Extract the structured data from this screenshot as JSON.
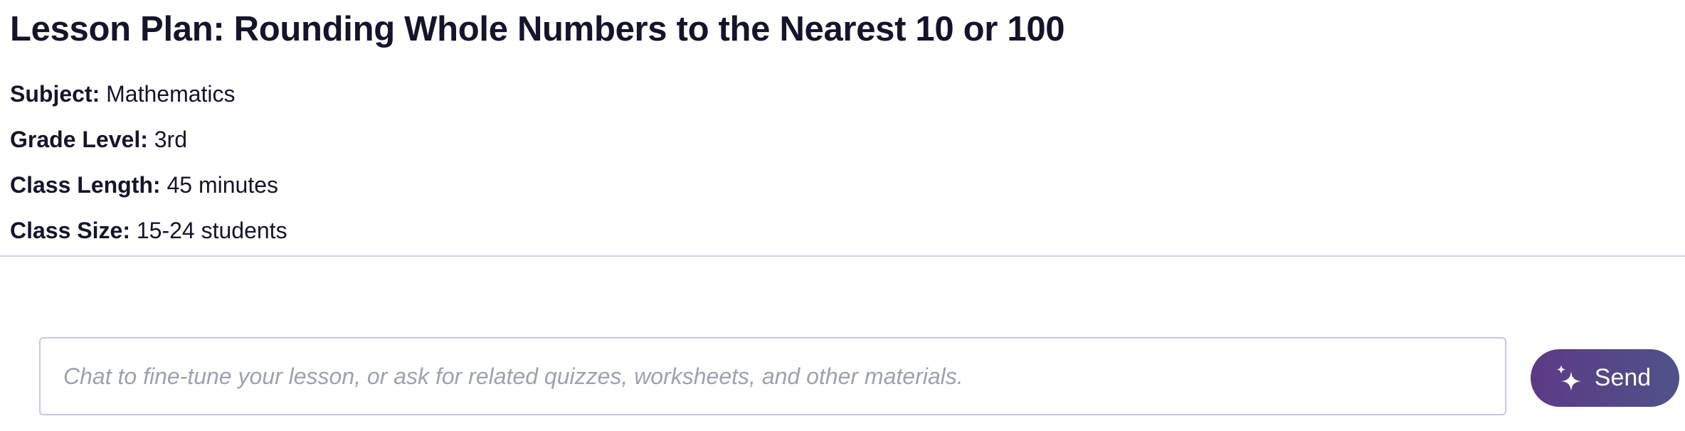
{
  "lesson": {
    "title": "Lesson Plan: Rounding Whole Numbers to the Nearest 10 or 100",
    "details": [
      {
        "label": "Subject:",
        "value": "Mathematics"
      },
      {
        "label": "Grade Level:",
        "value": "3rd"
      },
      {
        "label": "Class Length:",
        "value": "45 minutes"
      },
      {
        "label": "Class Size:",
        "value": "15-24 students"
      }
    ]
  },
  "chat": {
    "placeholder": "Chat to fine-tune your lesson, or ask for related quizzes, worksheets, and other materials.",
    "value": "",
    "send_label": "Send",
    "send_icon": "sparkle-icon"
  },
  "colors": {
    "text": "#14152b",
    "divider": "#d2d0ef",
    "input_border": "#c9c6ec",
    "placeholder": "#9ca2b0",
    "button_gradient_start": "#5d3a86",
    "button_gradient_end": "#4f528a"
  }
}
